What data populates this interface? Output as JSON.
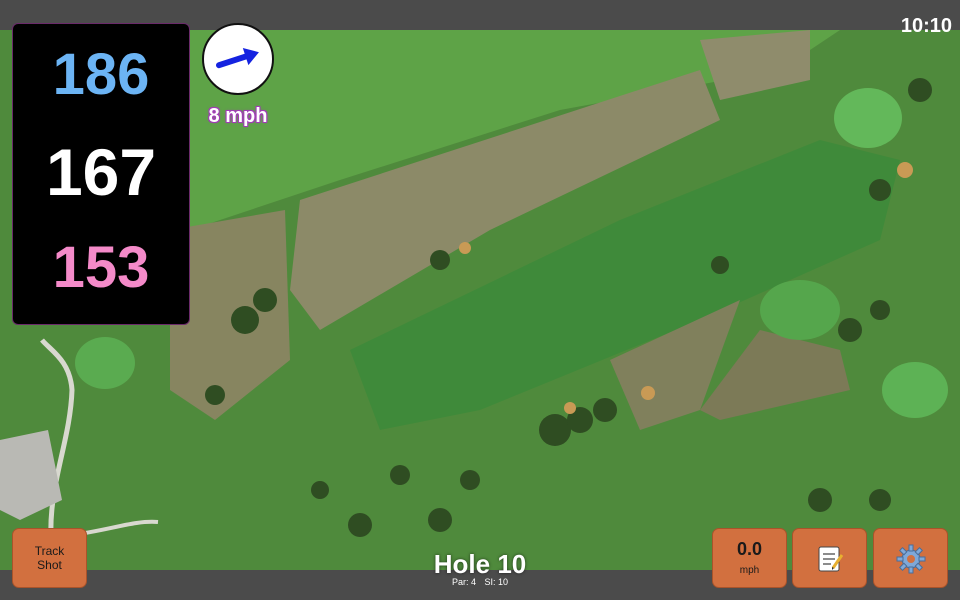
{
  "status": {
    "time": "10:10"
  },
  "distances": {
    "back": "186",
    "middle": "167",
    "front": "153"
  },
  "wind": {
    "speed_label": "8 mph",
    "direction_icon": "arrow-right-icon"
  },
  "hole": {
    "title": "Hole 10",
    "par_label": "Par: 4",
    "si_label": "SI: 10"
  },
  "buttons": {
    "track_shot_label": "Track Shot",
    "speed_value": "0.0",
    "speed_unit": "mph",
    "notes_icon": "notepad-icon",
    "settings_icon": "gear-icon"
  },
  "colors": {
    "back_distance": "#6cb4f4",
    "middle_distance": "#ffffff",
    "front_distance": "#f48ac9",
    "button_bg": "#d2703f",
    "wind_text_outline": "#a23ab8",
    "bar_bg": "#4b4b4b"
  }
}
